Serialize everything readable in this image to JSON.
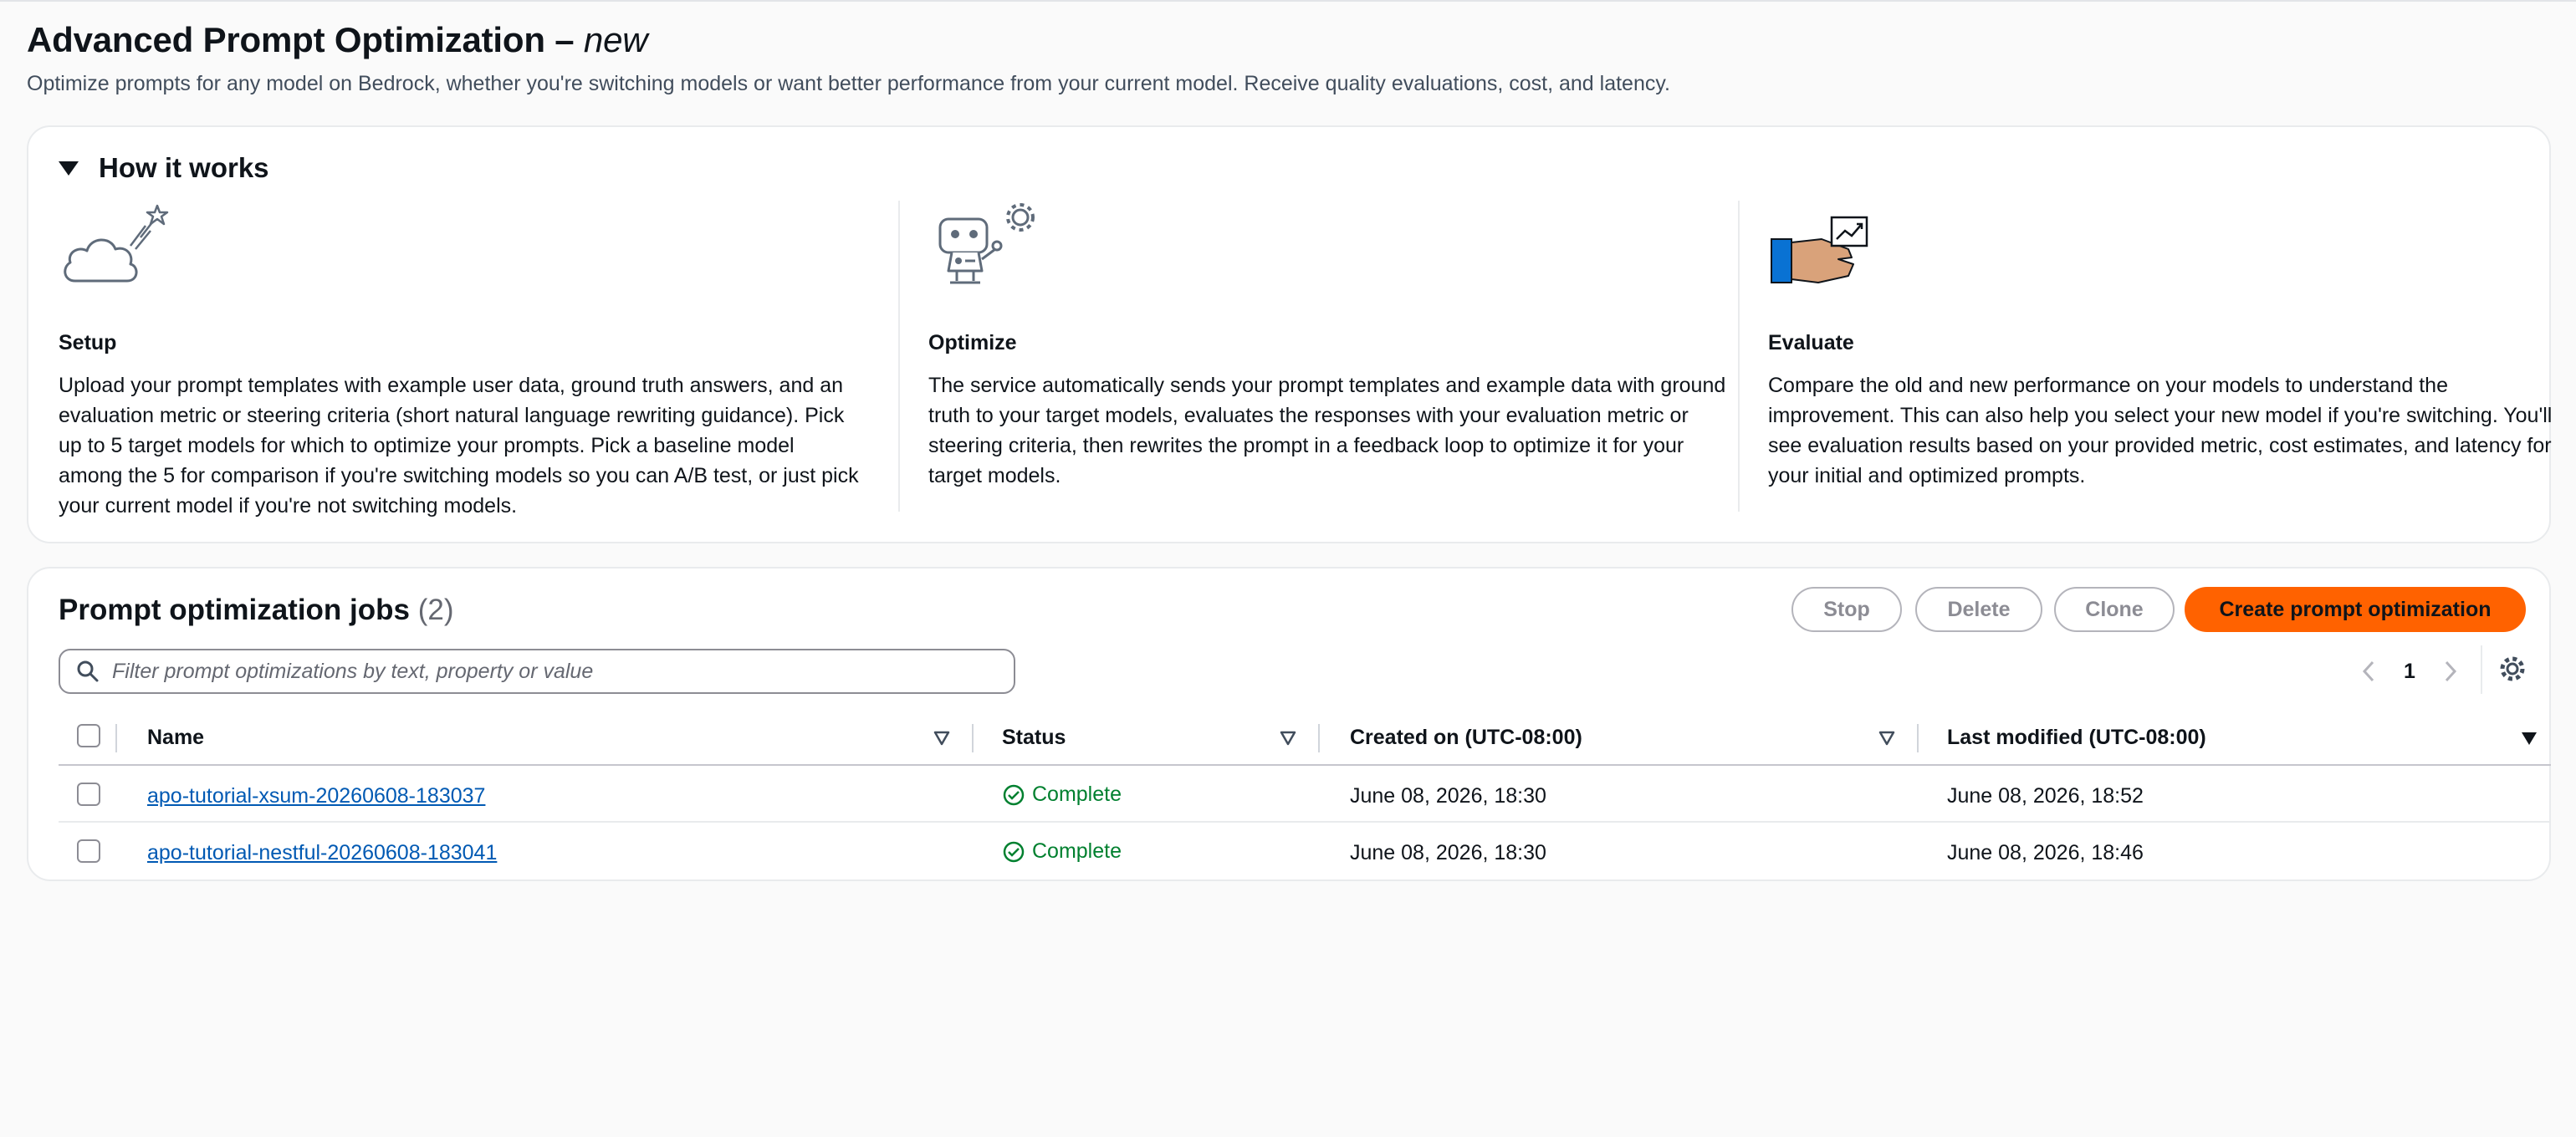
{
  "page": {
    "title_main": "Advanced Prompt Optimization –",
    "title_badge": "new",
    "description": "Optimize prompts for any model on Bedrock, whether you're switching models or want better performance from your current model. Receive quality evaluations, cost, and latency."
  },
  "how_it_works": {
    "title": "How it works",
    "steps": [
      {
        "icon": "cloud-star-icon",
        "title": "Setup",
        "text": "Upload your prompt templates with example user data, ground truth answers, and an evaluation metric or steering criteria (short natural language rewriting guidance). Pick up to 5 target models for which to optimize your prompts. Pick a baseline model among the 5 for comparison if you're switching models so you can A/B test, or just pick your current model if you're not switching models."
      },
      {
        "icon": "robot-gear-icon",
        "title": "Optimize",
        "text": "The service automatically sends your prompt templates and example data with ground truth to your target models, evaluates the responses with your evaluation metric or steering criteria, then rewrites the prompt in a feedback loop to optimize it for your target models."
      },
      {
        "icon": "hand-chart-icon",
        "title": "Evaluate",
        "text": "Compare the old and new performance on your models to understand the improvement. This can also help you select your new model if you're switching. You'll see evaluation results based on your provided metric, cost estimates, and latency for your initial and optimized prompts."
      }
    ]
  },
  "jobs": {
    "title": "Prompt optimization jobs",
    "count": "(2)",
    "buttons": {
      "stop": "Stop",
      "delete": "Delete",
      "clone": "Clone",
      "create": "Create prompt optimization"
    },
    "filter_placeholder": "Filter prompt optimizations by text, property or value",
    "current_page": "1",
    "columns": {
      "name": "Name",
      "status": "Status",
      "created": "Created on (UTC-08:00)",
      "modified": "Last modified (UTC-08:00)"
    },
    "rows": [
      {
        "name": "apo-tutorial-xsum-20260608-183037",
        "status": "Complete",
        "created": "June 08, 2026, 18:30",
        "modified": "June 08, 2026, 18:52"
      },
      {
        "name": "apo-tutorial-nestful-20260608-183041",
        "status": "Complete",
        "created": "June 08, 2026, 18:30",
        "modified": "June 08, 2026, 18:46"
      }
    ]
  },
  "colors": {
    "accent": "#ff6200",
    "link": "#0059b3",
    "success": "#00802f"
  }
}
